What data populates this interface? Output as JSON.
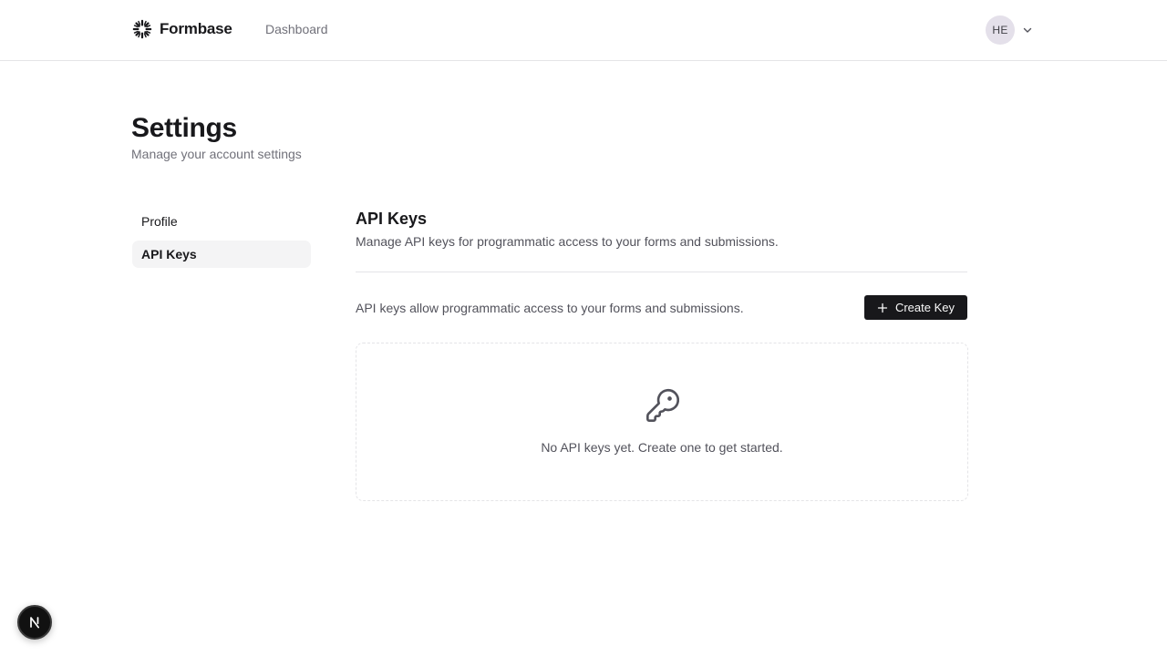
{
  "header": {
    "brand": "Formbase",
    "brand_icon": "sparkle-burst-icon",
    "nav": {
      "dashboard_label": "Dashboard"
    },
    "user": {
      "initials": "HE",
      "menu_icon": "chevron-down-icon"
    }
  },
  "page": {
    "title": "Settings",
    "subtitle": "Manage your account settings"
  },
  "sidebar": {
    "items": [
      {
        "label": "Profile",
        "active": false
      },
      {
        "label": "API Keys",
        "active": true
      }
    ]
  },
  "api_keys": {
    "title": "API Keys",
    "description": "Manage API keys for programmatic access to your forms and submissions.",
    "info": "API keys allow programmatic access to your forms and submissions.",
    "create_button_label": "Create Key",
    "create_button_icon": "plus-icon",
    "empty_icon": "key-icon",
    "empty_message": "No API keys yet. Create one to get started."
  },
  "dev_badge": {
    "icon": "nextjs-logo-icon"
  },
  "colors": {
    "primary": "#18181b",
    "muted_text": "#71717a",
    "border": "#e4e4e7",
    "active_bg": "#f4f4f5",
    "avatar_bg": "#e4e0ea"
  }
}
